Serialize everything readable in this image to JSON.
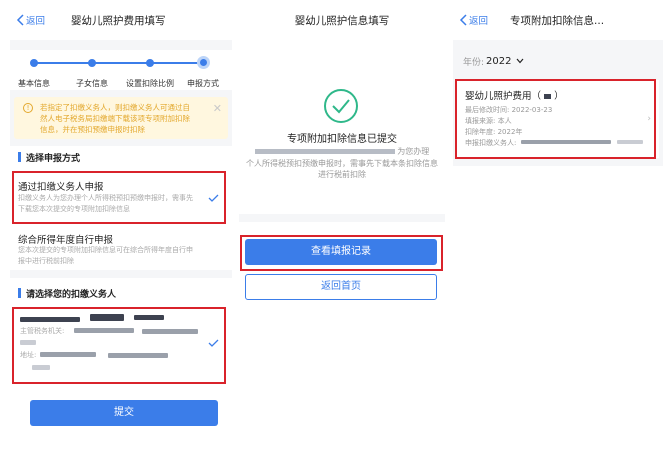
{
  "panel1": {
    "back_label": "返回",
    "title": "婴幼儿照护费用填写",
    "steps": [
      "基本信息",
      "子女信息",
      "设置扣除比例",
      "申报方式"
    ],
    "notice": "若指定了扣缴义务人，则扣缴义务人可通过自然人电子税务局扣缴端下载该项专项附加扣除信息，并在预扣预缴申报时扣除",
    "section_method_title": "选择申报方式",
    "option1_title": "通过扣缴义务人申报",
    "option1_desc": "扣缴义务人为您办理个人所得税预扣预缴申报时，需事先下载您本次提交的专项附加扣除信息",
    "option2_title": "综合所得年度自行申报",
    "option2_desc": "您本次提交的专项附加扣除信息可在综合所得年度自行申报中进行税前扣除",
    "section_withholder_title": "请选择您的扣缴义务人",
    "tax_office_label": "主管税务机关:",
    "address_label": "地址:",
    "submit_label": "提交"
  },
  "panel2": {
    "title": "婴幼儿照护信息填写",
    "success_title": "专项附加扣除信息已提交",
    "success_desc_tail": "为您办理",
    "success_desc_rest": "个人所得税预扣预缴申报时，需事先下载本条扣除信息进行税前扣除",
    "view_records_label": "查看填报记录",
    "back_home_label": "返回首页"
  },
  "panel3": {
    "back_label": "返回",
    "title": "专项附加扣除信息...",
    "year_label": "年份:",
    "year_value": "2022",
    "card_title": "婴幼儿照护费用（",
    "card_title_end": "）",
    "modified_label": "最后修改时间:",
    "modified_value": "2022-03-23",
    "source_label": "填报来源:",
    "source_value": "本人",
    "deduct_year_label": "扣除年度:",
    "deduct_year_value": "2022年",
    "declare_label": "申报扣缴义务人:"
  },
  "colors": {
    "accent": "#3b7de9",
    "highlight": "#d9232b",
    "notice": "#e3a82d",
    "success": "#2fb88a"
  },
  "icons": [
    "chevron-left-icon",
    "info-icon",
    "close-icon",
    "check-icon",
    "success-check-icon",
    "caret-down-icon",
    "chevron-right-icon"
  ]
}
